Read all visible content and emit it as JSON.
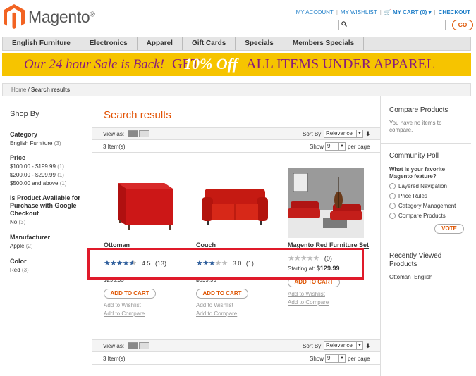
{
  "header": {
    "logo_text": "Magento",
    "logo_mark": "®",
    "links": [
      "My Account",
      "My Wishlist",
      "My Cart (0)",
      "Checkout"
    ],
    "search": {
      "value": "",
      "button": "GO"
    }
  },
  "nav": [
    "English Furniture",
    "Electronics",
    "Apparel",
    "Gift Cards",
    "Specials",
    "Members Specials"
  ],
  "banner": {
    "part1": "Our 24 hour Sale is Back!",
    "part2": "GET",
    "part3": "10% Off",
    "part4": "ALL ITEMS UNDER APPAREL"
  },
  "breadcrumb": {
    "home": "Home",
    "sep": "/",
    "current": "Search results"
  },
  "sidebar_left": {
    "title": "Shop By",
    "category_title": "Category",
    "category_item": "English Furniture",
    "category_count": "(3)",
    "price_title": "Price",
    "price_1": "$100.00 - $199.99",
    "price_1_count": "(1)",
    "price_2": "$200.00 - $299.99",
    "price_2_count": "(1)",
    "price_3": "$500.00 and above",
    "price_3_count": "(1)",
    "google_title_1": "Is Product Available for",
    "google_title_2": "Purchase with Google",
    "google_title_3": "Checkout",
    "google_item": "No",
    "google_count": "(3)",
    "manufacturer_title": "Manufacturer",
    "manufacturer_item": "Apple",
    "manufacturer_count": "(2)",
    "color_title": "Color",
    "color_item": "Red",
    "color_count": "(3)"
  },
  "main": {
    "title": "Search results",
    "view_as": "View as:",
    "sort_by": "Sort By",
    "sort_value": "Relevance",
    "items": "3 Item(s)",
    "show": "Show",
    "show_value": "9",
    "per_page": "per page",
    "add_to_cart": "ADD TO CART",
    "add_wishlist": "Add to Wishlist",
    "add_compare": "Add to Compare"
  },
  "products": [
    {
      "name": "Ottoman",
      "rating": 4.5,
      "rating_text": "4.5",
      "reviews": "(13)",
      "price": "$299.99"
    },
    {
      "name": "Couch",
      "rating": 3.0,
      "rating_text": "3.0",
      "reviews": "(1)",
      "price": "$599.99"
    },
    {
      "name": "Magento Red Furniture Set",
      "rating": 0,
      "reviews": "(0)",
      "price_label": "Starting at:",
      "price": "$129.99"
    }
  ],
  "sidebar_right": {
    "compare_title": "Compare Products",
    "compare_text_1": "You have no items to",
    "compare_text_2": "compare.",
    "poll_title": "Community Poll",
    "poll_q_1": "What is your favorite",
    "poll_q_2": "Magento feature?",
    "poll_options": [
      "Layered Navigation",
      "Price Rules",
      "Category Management",
      "Compare Products"
    ],
    "vote": "VOTE",
    "recent_title_1": "Recently Viewed",
    "recent_title_2": "Products",
    "recent_item": "Ottoman_English"
  },
  "colors": {
    "accent": "#e25203",
    "link": "#1e7ec8",
    "star": "#2d5d9b",
    "highlight": "#e01a2a",
    "banner": "#f6c400"
  }
}
